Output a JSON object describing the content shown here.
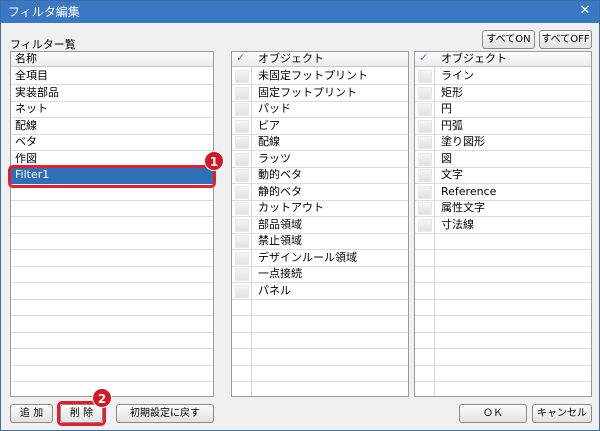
{
  "window": {
    "title": "フィルタ編集",
    "close_glyph": "✕"
  },
  "filter_list": {
    "section_label": "フィルター覧",
    "column_header": "名称",
    "items": [
      "全項目",
      "実装部品",
      "ネット",
      "配線",
      "ベタ",
      "作図",
      "Filter1"
    ],
    "selected": "Filter1"
  },
  "objects_left": {
    "header": "オブジェクト",
    "check_glyph": "✓",
    "items": [
      "未固定フットプリント",
      "固定フットプリント",
      "パッド",
      "ビア",
      "配線",
      "ラッツ",
      "動的ベタ",
      "静的ベタ",
      "カットアウト",
      "部品領域",
      "禁止領域",
      "デザインルール領域",
      "一点接続",
      "パネル"
    ]
  },
  "objects_right": {
    "header": "オブジェクト",
    "check_glyph": "✓",
    "items": [
      "ライン",
      "矩形",
      "円",
      "円弧",
      "塗り図形",
      "図",
      "文字",
      "Reference",
      "属性文字",
      "寸法線"
    ]
  },
  "buttons": {
    "all_on": "すべてON",
    "all_off": "すべてOFF",
    "add": "追 加",
    "delete": "削 除",
    "reset": "初期設定に戻す",
    "ok": "ＯＫ",
    "cancel": "キャンセル"
  },
  "callouts": {
    "one": "1",
    "two": "2",
    "color": "#e51d2c"
  }
}
